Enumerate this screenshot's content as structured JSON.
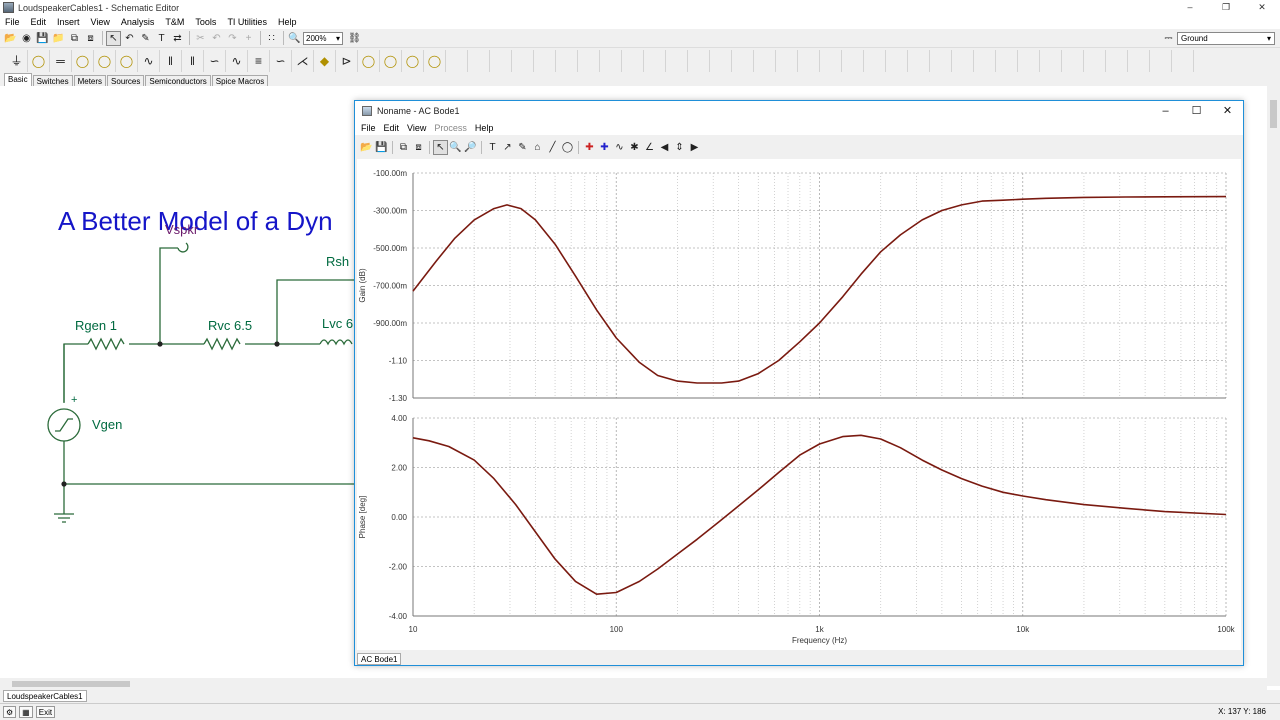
{
  "app": {
    "title": "LoudspeakerCables1 - Schematic Editor",
    "menu": [
      "File",
      "Edit",
      "Insert",
      "View",
      "Analysis",
      "T&M",
      "Tools",
      "TI Utilities",
      "Help"
    ],
    "zoom": "200%",
    "ground_select": "Ground",
    "component_tabs": [
      "Basic",
      "Switches",
      "Meters",
      "Sources",
      "Semiconductors",
      "Spice Macros"
    ],
    "active_tab": "Basic"
  },
  "schematic": {
    "heading": "A Better Model of a Dyn",
    "labels": {
      "vspkr": "Vspkr",
      "rgen": "Rgen 1",
      "rvc": "Rvc 6.5",
      "rsh": "Rsh",
      "lvc": "Lvc 6",
      "vgen": "Vgen",
      "plus": "+"
    }
  },
  "bode": {
    "title": "Noname - AC Bode1",
    "menu": [
      "File",
      "Edit",
      "View",
      "Process",
      "Help"
    ],
    "menu_disabled": [
      "Process"
    ],
    "tab": "AC Bode1"
  },
  "bottom": {
    "sheet_tab": "LoudspeakerCables1",
    "exit_label": "Exit",
    "coords": "X: 137  Y: 186"
  },
  "chart_data": [
    {
      "type": "line",
      "title": "",
      "xlabel": "Frequency (Hz)",
      "ylabel": "Gain (dB)",
      "xscale": "log",
      "xlim": [
        10,
        100000
      ],
      "ylim": [
        -1.3,
        -0.1
      ],
      "x_ticks": [
        "10",
        "100",
        "1k",
        "10k",
        "100k"
      ],
      "y_ticks": [
        "-100.00m",
        "-300.00m",
        "-500.00m",
        "-700.00m",
        "-900.00m",
        "-1.10",
        "-1.30"
      ],
      "grid": true,
      "series": [
        {
          "color": "#7a1a10",
          "x": [
            10,
            13,
            16,
            20,
            25,
            29,
            34,
            40,
            50,
            63,
            80,
            100,
            130,
            160,
            200,
            250,
            330,
            400,
            500,
            630,
            800,
            1000,
            1300,
            1600,
            2000,
            2500,
            3200,
            4000,
            5000,
            6300,
            8000,
            10000,
            13000,
            20000,
            32000,
            50000,
            100000
          ],
          "y": [
            -0.73,
            -0.57,
            -0.45,
            -0.35,
            -0.29,
            -0.27,
            -0.29,
            -0.35,
            -0.48,
            -0.65,
            -0.83,
            -0.98,
            -1.11,
            -1.18,
            -1.21,
            -1.22,
            -1.22,
            -1.21,
            -1.17,
            -1.1,
            -1.0,
            -0.9,
            -0.76,
            -0.64,
            -0.52,
            -0.43,
            -0.35,
            -0.3,
            -0.27,
            -0.25,
            -0.245,
            -0.24,
            -0.235,
            -0.23,
            -0.228,
            -0.227,
            -0.226
          ]
        }
      ]
    },
    {
      "type": "line",
      "title": "",
      "xlabel": "Frequency (Hz)",
      "ylabel": "Phase [deg]",
      "xscale": "log",
      "xlim": [
        10,
        100000
      ],
      "ylim": [
        -4,
        4
      ],
      "x_ticks": [
        "10",
        "100",
        "1k",
        "10k",
        "100k"
      ],
      "y_ticks": [
        "4.00",
        "2.00",
        "0.00",
        "-2.00",
        "-4.00"
      ],
      "grid": true,
      "series": [
        {
          "color": "#7a1a10",
          "x": [
            10,
            12,
            15,
            20,
            25,
            32,
            40,
            50,
            63,
            80,
            100,
            130,
            160,
            200,
            250,
            320,
            400,
            500,
            630,
            800,
            1000,
            1300,
            1600,
            2000,
            2500,
            3200,
            4000,
            5000,
            6300,
            8000,
            10000,
            13000,
            16000,
            20000,
            32000,
            50000,
            100000
          ],
          "y": [
            3.2,
            3.08,
            2.85,
            2.3,
            1.55,
            0.5,
            -0.6,
            -1.7,
            -2.6,
            -3.12,
            -3.05,
            -2.6,
            -2.1,
            -1.5,
            -0.9,
            -0.2,
            0.45,
            1.1,
            1.8,
            2.5,
            2.95,
            3.25,
            3.3,
            3.15,
            2.8,
            2.3,
            1.9,
            1.55,
            1.25,
            1.0,
            0.85,
            0.7,
            0.6,
            0.5,
            0.35,
            0.22,
            0.1
          ]
        }
      ]
    }
  ]
}
